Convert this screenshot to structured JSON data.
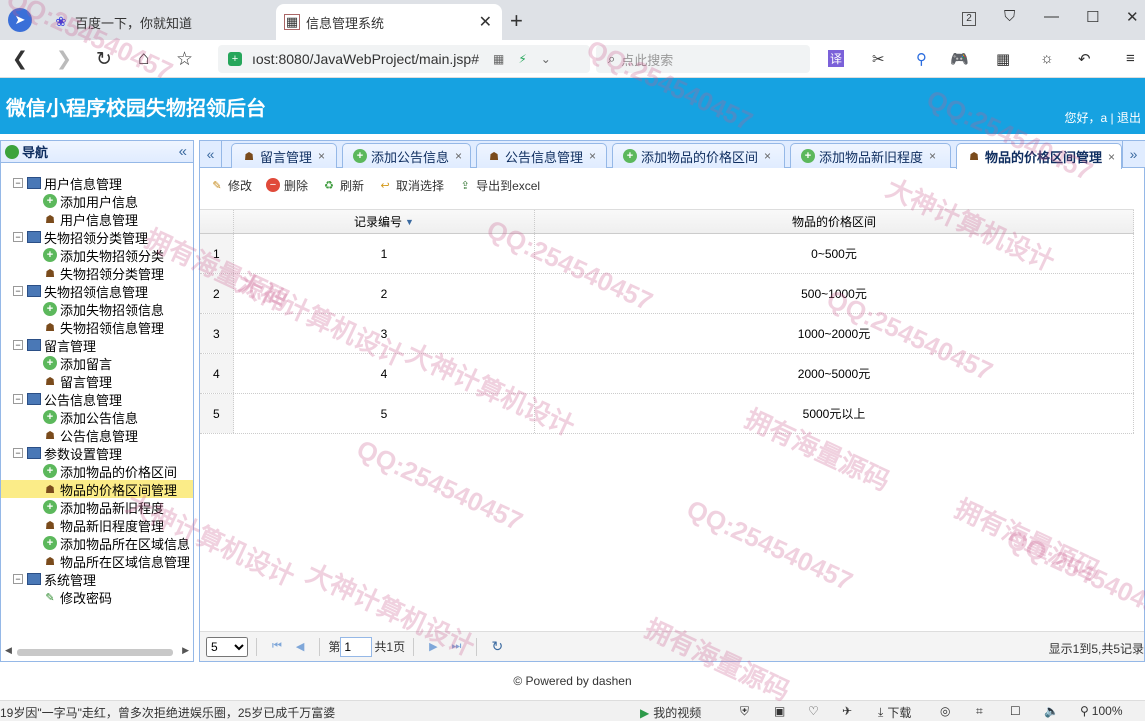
{
  "browser": {
    "tabs": [
      {
        "title": "百度一下，你就知道",
        "active": false
      },
      {
        "title": "信息管理系统",
        "active": true
      }
    ],
    "url": "ıost:8080/JavaWebProject/main.jsp#",
    "search_placeholder": "点此搜索",
    "tab_count_badge": "2"
  },
  "app": {
    "title": "微信小程序校园失物招领后台",
    "greeting": "您好，a",
    "logout": "退出"
  },
  "nav": {
    "title": "导航",
    "groups": [
      {
        "label": "用户信息管理",
        "items": [
          "添加用户信息",
          "用户信息管理"
        ]
      },
      {
        "label": "失物招领分类管理",
        "items": [
          "添加失物招领分类",
          "失物招领分类管理"
        ]
      },
      {
        "label": "失物招领信息管理",
        "items": [
          "添加失物招领信息",
          "失物招领信息管理"
        ]
      },
      {
        "label": "留言管理",
        "items": [
          "添加留言",
          "留言管理"
        ]
      },
      {
        "label": "公告信息管理",
        "items": [
          "添加公告信息",
          "公告信息管理"
        ]
      },
      {
        "label": "参数设置管理",
        "items": [
          "添加物品的价格区间",
          "物品的价格区间管理",
          "添加物品新旧程度",
          "物品新旧程度管理",
          "添加物品所在区域信息",
          "物品所在区域信息管理"
        ]
      },
      {
        "label": "系统管理",
        "items": [
          "修改密码"
        ]
      }
    ],
    "selected": "物品的价格区间管理"
  },
  "panel_tabs": [
    {
      "label": "留言管理",
      "icon": "user-icon"
    },
    {
      "label": "添加公告信息",
      "icon": "add-icon"
    },
    {
      "label": "公告信息管理",
      "icon": "user-icon"
    },
    {
      "label": "添加物品的价格区间",
      "icon": "add-icon"
    },
    {
      "label": "添加物品新旧程度",
      "icon": "add-icon"
    },
    {
      "label": "物品的价格区间管理",
      "icon": "user-icon",
      "selected": true
    }
  ],
  "toolbar": {
    "edit": "修改",
    "delete": "删除",
    "refresh": "刷新",
    "unselect": "取消选择",
    "export": "导出到excel"
  },
  "grid": {
    "columns": [
      "记录编号",
      "物品的价格区间"
    ],
    "rows": [
      {
        "index": "1",
        "id": "1",
        "range": "0~500元"
      },
      {
        "index": "2",
        "id": "2",
        "range": "500~1000元"
      },
      {
        "index": "3",
        "id": "3",
        "range": "1000~2000元"
      },
      {
        "index": "4",
        "id": "4",
        "range": "2000~5000元"
      },
      {
        "index": "5",
        "id": "5",
        "range": "5000元以上"
      }
    ]
  },
  "pager": {
    "page_size": "5",
    "page_label_before": "第",
    "page_value": "1",
    "page_label_after": "共1页",
    "info": "显示1到5,共5记录"
  },
  "footer": "© Powered by dashen",
  "statusbar": {
    "news": "19岁因\"一字马\"走红，曾多次拒绝进娱乐圈，25岁已成千万富婆",
    "video": "我的视频",
    "download": "下载",
    "zoom": "100%"
  },
  "watermarks": [
    "QQ:254540457",
    "大神计算机设计",
    "拥有海量源码"
  ]
}
